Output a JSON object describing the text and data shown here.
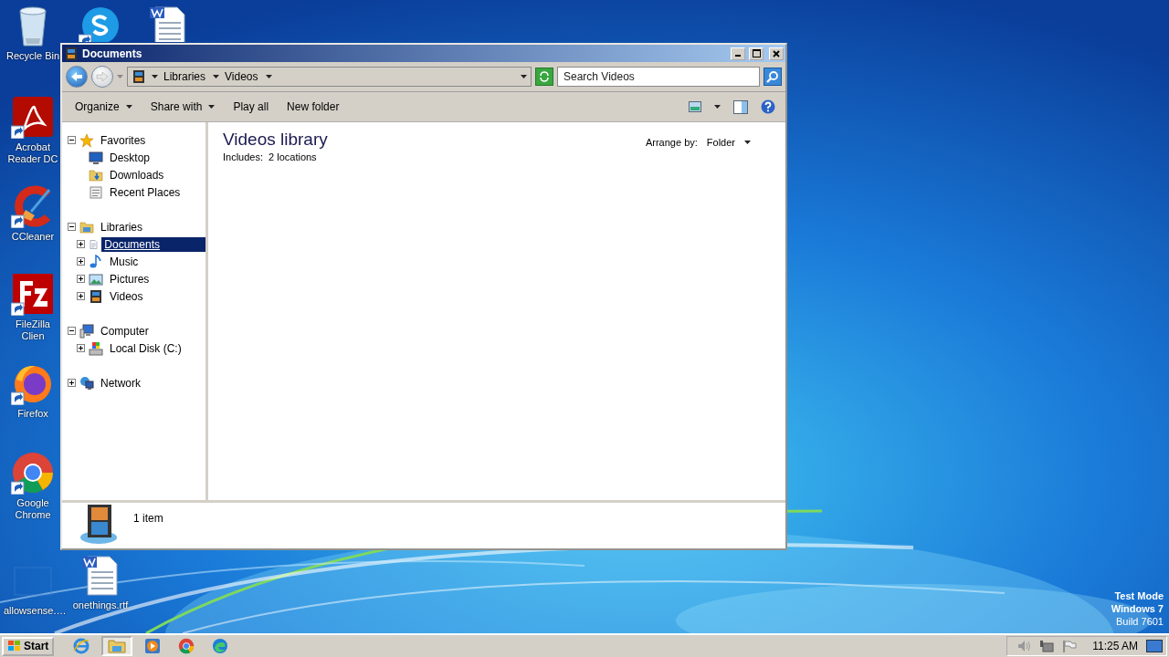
{
  "desktop": {
    "icons": [
      {
        "kind": "recycle-bin",
        "label": "Recycle Bin"
      },
      {
        "kind": "skype"
      },
      {
        "kind": "word"
      },
      {
        "kind": "acrobat",
        "label": "Acrobat Reader DC"
      },
      {
        "kind": "ccleaner",
        "label": "CCleaner"
      },
      {
        "kind": "filezilla",
        "label": "FileZilla Clien"
      },
      {
        "kind": "firefox",
        "label": "Firefox"
      },
      {
        "kind": "chrome",
        "label": "Google Chrome"
      },
      {
        "kind": "blank",
        "label": "allowsense.…"
      },
      {
        "kind": "word",
        "label": "onethings.rtf"
      }
    ],
    "watermark": [
      "Test Mode",
      "Windows 7",
      "Build 7601"
    ]
  },
  "window": {
    "title": "Documents",
    "breadcrumb": [
      "Libraries",
      "Videos"
    ],
    "search": {
      "placeholder": "Search Videos"
    },
    "toolbar": [
      {
        "label": "Organize",
        "dropdown": true
      },
      {
        "label": "Share with",
        "dropdown": true
      },
      {
        "label": "Play all",
        "dropdown": false
      },
      {
        "label": "New folder",
        "dropdown": false
      }
    ],
    "nav": [
      {
        "kind": "favorites",
        "label": "Favorites",
        "expanded": true,
        "selected": false,
        "children": [
          {
            "kind": "desktop",
            "label": "Desktop",
            "selected": false
          },
          {
            "kind": "downloads",
            "label": "Downloads",
            "selected": false
          },
          {
            "kind": "recent",
            "label": "Recent Places",
            "selected": false
          }
        ]
      },
      {
        "kind": "libraries",
        "label": "Libraries",
        "expanded": true,
        "selected": false,
        "children": [
          {
            "kind": "documents",
            "label": "Documents",
            "expanded": false,
            "selected": true
          },
          {
            "kind": "music",
            "label": "Music",
            "expanded": false,
            "selected": false
          },
          {
            "kind": "pictures",
            "label": "Pictures",
            "expanded": false,
            "selected": false
          },
          {
            "kind": "videos",
            "label": "Videos",
            "expanded": false,
            "selected": false
          }
        ]
      },
      {
        "kind": "computer",
        "label": "Computer",
        "expanded": true,
        "selected": false,
        "children": [
          {
            "kind": "disk",
            "label": "Local Disk (C:)",
            "expanded": false,
            "selected": false
          }
        ]
      },
      {
        "kind": "network",
        "label": "Network",
        "expanded": false,
        "selected": false
      }
    ],
    "content": {
      "title": "Videos library",
      "includes_label": "Includes:",
      "includes_link": "2 locations",
      "arrange_label": "Arrange by:",
      "arrange_value": "Folder"
    },
    "status": {
      "text": "1 item"
    }
  },
  "taskbar": {
    "start": "Start",
    "apps": [
      {
        "kind": "ie",
        "selected": false
      },
      {
        "kind": "explorer",
        "selected": true
      },
      {
        "kind": "media-player",
        "selected": false
      },
      {
        "kind": "chrome",
        "selected": false
      },
      {
        "kind": "edge",
        "selected": false
      }
    ],
    "clock": "11:25 AM"
  }
}
